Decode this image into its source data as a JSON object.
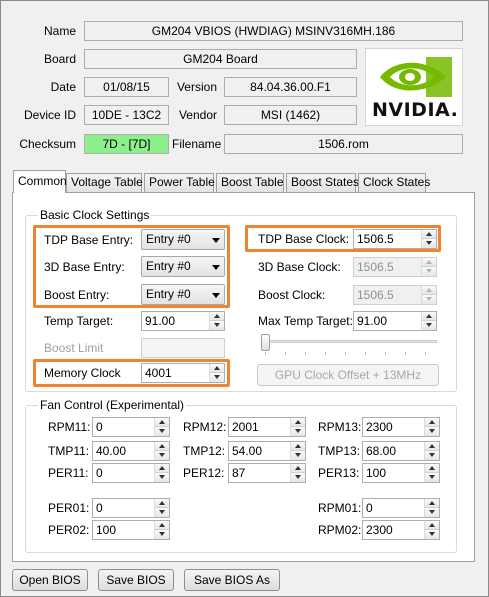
{
  "info": {
    "name_label": "Name",
    "name_value": "GM204 VBIOS (HWDIAG) MSINV316MH.186",
    "board_label": "Board",
    "board_value": "GM204 Board",
    "date_label": "Date",
    "date_value": "01/08/15",
    "version_label": "Version",
    "version_value": "84.04.36.00.F1",
    "device_label": "Device ID",
    "device_value": "10DE - 13C2",
    "vendor_label": "Vendor",
    "vendor_value": "MSI (1462)",
    "checksum_label": "Checksum",
    "checksum_value": "7D - [7D]",
    "filename_label": "Filename",
    "filename_value": "1506.rom",
    "logo_text": "NVIDIA."
  },
  "tabs": [
    "Common",
    "Voltage Table",
    "Power Table",
    "Boost Table",
    "Boost States",
    "Clock States"
  ],
  "basic": {
    "title": "Basic Clock Settings",
    "tdp_base_entry_label": "TDP Base Entry:",
    "tdp_base_entry_value": "Entry #0",
    "base_3d_entry_label": "3D Base Entry:",
    "base_3d_entry_value": "Entry #0",
    "boost_entry_label": "Boost Entry:",
    "boost_entry_value": "Entry #0",
    "temp_target_label": "Temp Target:",
    "temp_target_value": "91.00",
    "boost_limit_label": "Boost Limit",
    "memory_clock_label": "Memory Clock",
    "memory_clock_value": "4001",
    "tdp_base_clock_label": "TDP Base Clock:",
    "tdp_base_clock_value": "1506.5",
    "base_3d_clock_label": "3D Base Clock:",
    "base_3d_clock_value": "1506.5",
    "boost_clock_label": "Boost Clock:",
    "boost_clock_value": "1506.5",
    "max_temp_label": "Max Temp Target:",
    "max_temp_value": "91.00",
    "gpu_offset_label": "GPU Clock Offset + 13MHz"
  },
  "fan": {
    "title": "Fan Control (Experimental)",
    "rpm11_label": "RPM11:",
    "rpm11_value": "0",
    "tmp11_label": "TMP11:",
    "tmp11_value": "40.00",
    "per11_label": "PER11:",
    "per11_value": "0",
    "rpm12_label": "RPM12:",
    "rpm12_value": "2001",
    "tmp12_label": "TMP12:",
    "tmp12_value": "54.00",
    "per12_label": "PER12:",
    "per12_value": "87",
    "rpm13_label": "RPM13:",
    "rpm13_value": "2300",
    "tmp13_label": "TMP13:",
    "tmp13_value": "68.00",
    "per13_label": "PER13:",
    "per13_value": "100",
    "per01_label": "PER01:",
    "per01_value": "0",
    "per02_label": "PER02:",
    "per02_value": "100",
    "rpm01_label": "RPM01:",
    "rpm01_value": "0",
    "rpm02_label": "RPM02:",
    "rpm02_value": "2300"
  },
  "buttons": {
    "open": "Open BIOS",
    "save": "Save BIOS",
    "save_as": "Save BIOS As"
  },
  "colors": {
    "highlight": "#f0832f",
    "checksum_bg": "#8ef08c",
    "nvidia_green": "#76b900"
  }
}
